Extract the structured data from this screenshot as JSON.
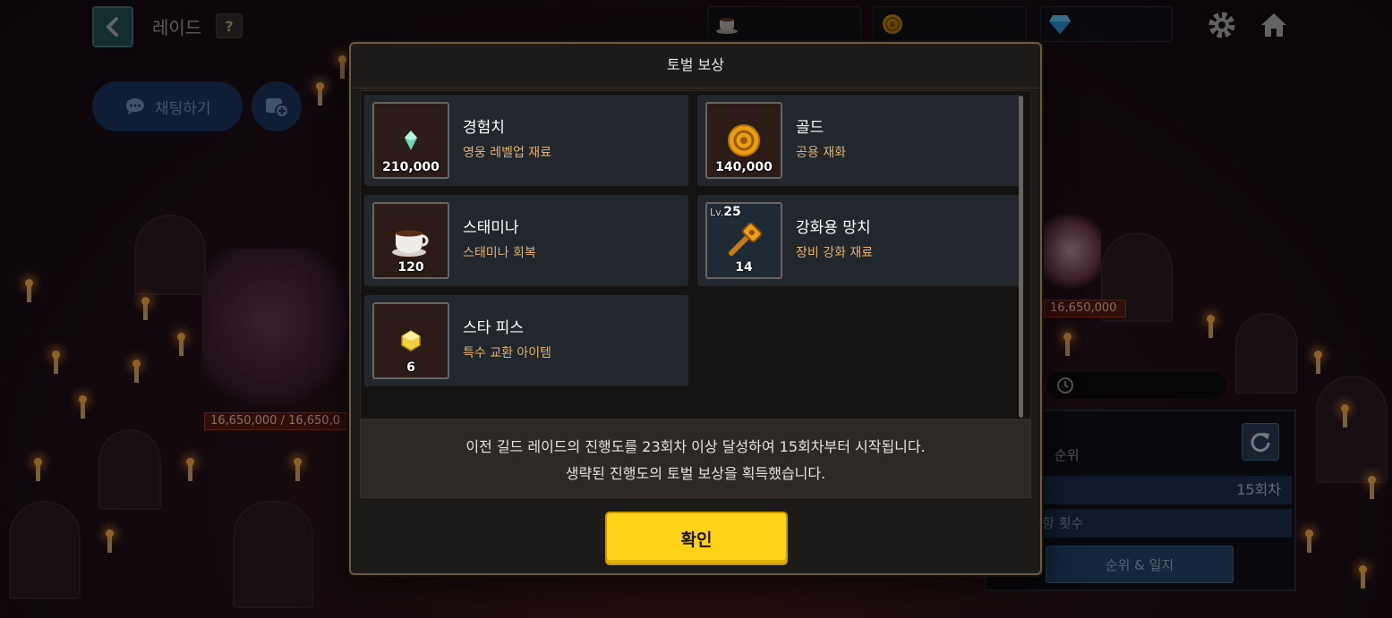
{
  "header": {
    "title": "레이드",
    "help_label": "?",
    "back_icon": "chevron-left-icon"
  },
  "currencies": [
    {
      "icon": "coffee-cup-icon",
      "value": ""
    },
    {
      "icon": "gold-coin-icon",
      "value": ""
    },
    {
      "icon": "diamond-icon",
      "value": ""
    }
  ],
  "chat": {
    "label": "채팅하기"
  },
  "bosses": {
    "left_hp": "16,650,000 / 16,650,0",
    "right_hp": "16,650,000"
  },
  "side_panel": {
    "rank_label": "순위",
    "round_value": "15회차",
    "count_label": "횟수",
    "count_prefix": "항",
    "rank_button": "순위 & 일지"
  },
  "modal": {
    "title": "토벌 보상",
    "rewards": [
      {
        "name": "경험치",
        "desc": "영웅 레벨업 재료",
        "qty": "210,000",
        "icon": "exp-crystal-icon"
      },
      {
        "name": "골드",
        "desc": "공용 재화",
        "qty": "140,000",
        "icon": "gold-coin-icon"
      },
      {
        "name": "스태미나",
        "desc": "스태미나 회복",
        "qty": "120",
        "icon": "coffee-cup-icon"
      },
      {
        "name": "강화용 망치",
        "desc": "장비 강화 재료",
        "qty": "14",
        "level_prefix": "Lv.",
        "level": "25",
        "icon": "hammer-icon"
      },
      {
        "name": "스타 피스",
        "desc": "특수 교환 아이템",
        "qty": "6",
        "icon": "star-piece-icon"
      }
    ],
    "notice_line1": "이전 길드 레이드의 진행도를 23회차 이상 달성하여 15회차부터 시작됩니다.",
    "notice_line2": "생략된 진행도의 토벌 보상을 획득했습니다.",
    "confirm_label": "확인"
  },
  "colors": {
    "accent_yellow": "#ffd21a",
    "desc_orange": "#e2b270",
    "modal_border": "#6c5a3a",
    "card_bg": "#22262d"
  }
}
